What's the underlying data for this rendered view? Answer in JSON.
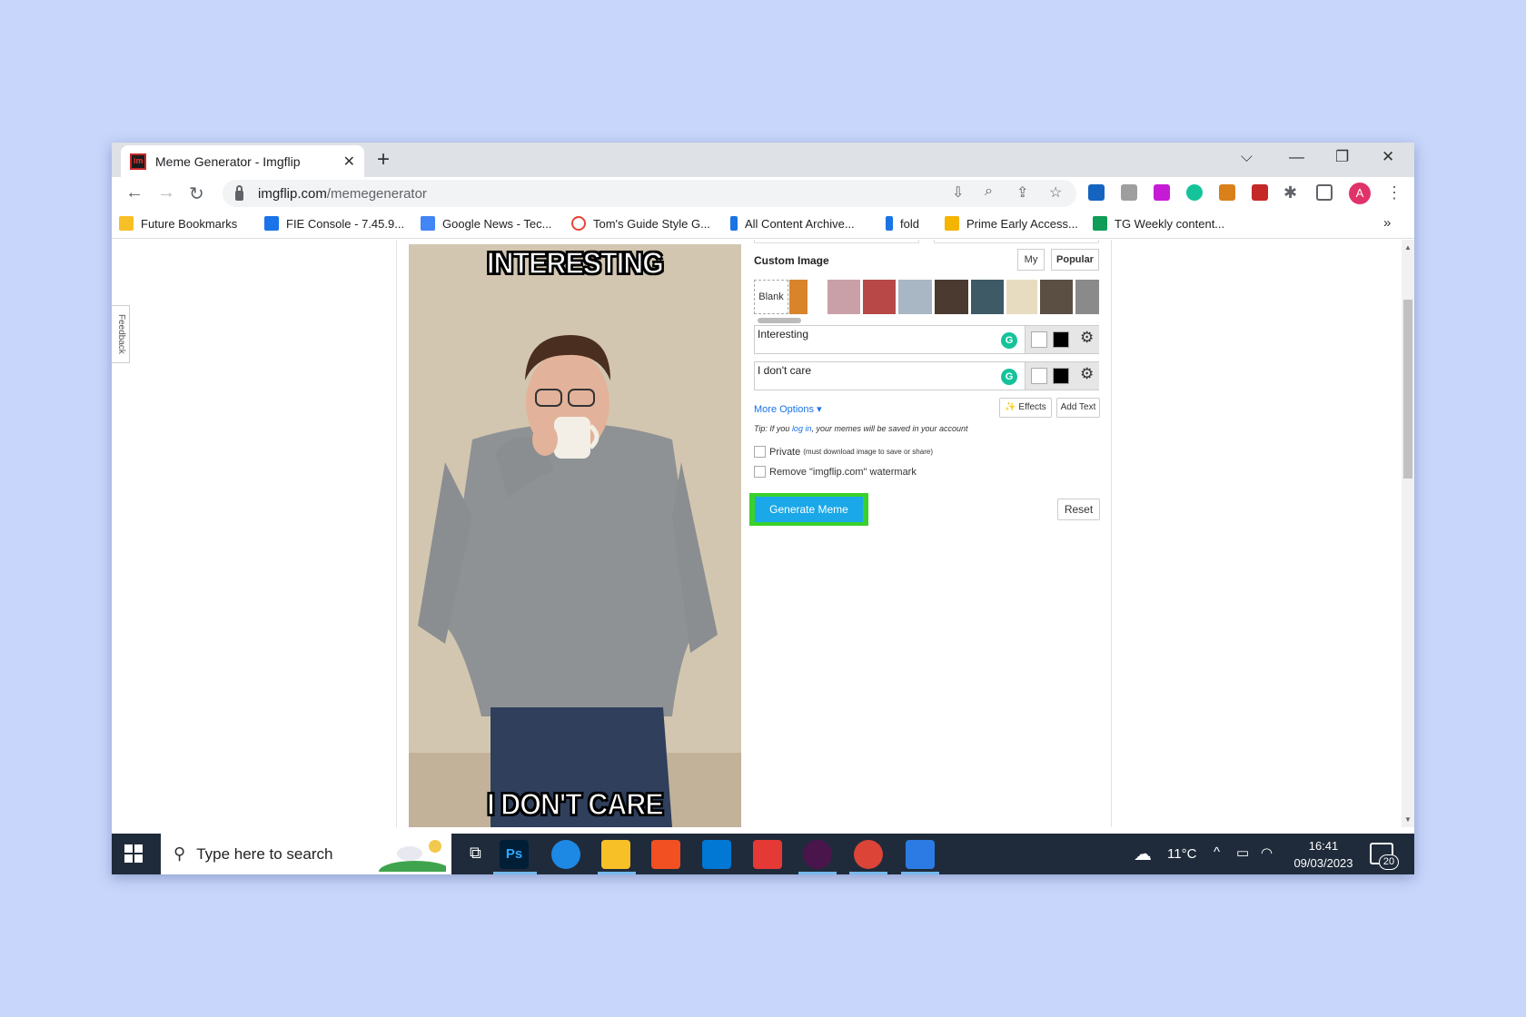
{
  "browser": {
    "tab_title": "Meme Generator - Imgflip",
    "url_host": "imgflip.com",
    "url_path": "/memegenerator",
    "profile_initial": "A"
  },
  "bookmarks": [
    {
      "label": "Future Bookmarks",
      "color": "#f6c026"
    },
    {
      "label": "FIE Console - 7.45.9...",
      "color": "#1a73e8"
    },
    {
      "label": "Google News - Tec...",
      "color": "#4285f4"
    },
    {
      "label": "Tom's Guide Style G...",
      "color": "#ea4335"
    },
    {
      "label": "All Content Archive...",
      "color": "#1b74e4"
    },
    {
      "label": "fold",
      "color": "#1b74e4"
    },
    {
      "label": "Prime Early Access...",
      "color": "#f4b400"
    },
    {
      "label": "TG Weekly content...",
      "color": "#0f9d58"
    }
  ],
  "feedback_label": "Feedback",
  "meme": {
    "top_text": "INTERESTING",
    "bottom_text": "I DON'T CARE"
  },
  "editor": {
    "custom_image_label": "Custom Image",
    "tab_my": "My",
    "tab_popular": "Popular",
    "blank_label": "Blank",
    "text_boxes": [
      {
        "value": "Interesting"
      },
      {
        "value": "I don't care"
      }
    ],
    "more_options": "More Options ▾",
    "effects_label": "Effects",
    "add_text_label": "Add Text",
    "tip_prefix": "Tip: If you ",
    "tip_link": "log in",
    "tip_suffix": ", your memes will be saved in your account",
    "private_label": "Private",
    "private_note": "(must download image to save or share)",
    "watermark_label": "Remove \"imgflip.com\" watermark",
    "generate_label": "Generate Meme",
    "reset_label": "Reset"
  },
  "taskbar": {
    "search_placeholder": "Type here to search",
    "temperature": "11°C",
    "time": "16:41",
    "date": "09/03/2023",
    "notification_count": "20",
    "photoshop_label": "Ps"
  },
  "colors": {
    "background": "#c8d6fb",
    "generate_button": "#1aa8e8",
    "generate_highlight": "#39d12c",
    "grammarly": "#15c39a"
  }
}
